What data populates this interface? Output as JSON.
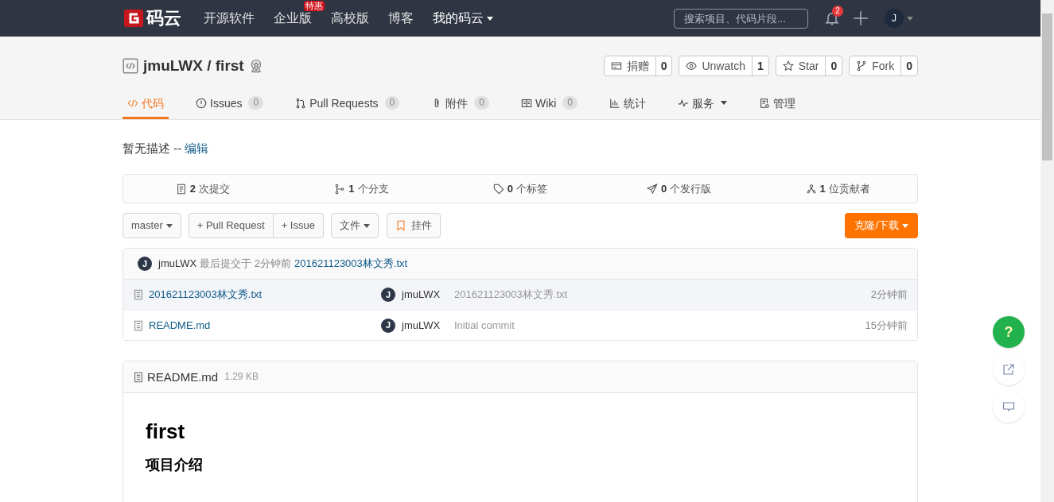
{
  "nav": {
    "logo": "码云",
    "items": [
      {
        "label": "开源软件",
        "dropdown": false
      },
      {
        "label": "企业版",
        "badge": "特惠",
        "dropdown": false
      },
      {
        "label": "高校版",
        "dropdown": false
      },
      {
        "label": "博客",
        "dropdown": false
      },
      {
        "label": "我的码云",
        "dropdown": true
      }
    ],
    "search": {
      "placeholder": "搜索项目、代码片段..."
    },
    "notifications": "2",
    "avatar": "J"
  },
  "repo": {
    "owner": "jmuLWX",
    "separator": "/",
    "name": "first",
    "actions": [
      {
        "kind": "donate",
        "label": "捐赠",
        "count": "0"
      },
      {
        "kind": "watch",
        "label": "Unwatch",
        "count": "1"
      },
      {
        "kind": "star",
        "label": "Star",
        "count": "0"
      },
      {
        "kind": "fork",
        "label": "Fork",
        "count": "0"
      }
    ],
    "tabs": [
      {
        "kind": "code",
        "label": "代码",
        "selected": true,
        "dropdown": false
      },
      {
        "kind": "issues",
        "label": "Issues",
        "count": "0",
        "selected": false,
        "dropdown": false
      },
      {
        "kind": "pr",
        "label": "Pull Requests",
        "count": "0",
        "selected": false,
        "dropdown": false
      },
      {
        "kind": "attach",
        "label": "附件",
        "count": "0",
        "selected": false,
        "dropdown": false
      },
      {
        "kind": "wiki",
        "label": "Wiki",
        "count": "0",
        "selected": false,
        "dropdown": false
      },
      {
        "kind": "stats",
        "label": "统计",
        "selected": false,
        "dropdown": false
      },
      {
        "kind": "service",
        "label": "服务",
        "selected": false,
        "dropdown": true
      },
      {
        "kind": "manage",
        "label": "管理",
        "selected": false,
        "dropdown": false
      }
    ]
  },
  "description": {
    "text": "暂无描述",
    "separator": "--",
    "link": "编辑"
  },
  "stats": [
    {
      "kind": "commits",
      "count": "2",
      "label": "次提交"
    },
    {
      "kind": "branches",
      "count": "1",
      "label": "个分支"
    },
    {
      "kind": "tags",
      "count": "0",
      "label": "个标签"
    },
    {
      "kind": "releases",
      "count": "0",
      "label": "个发行版"
    },
    {
      "kind": "contributors",
      "count": "1",
      "label": "位贡献者"
    }
  ],
  "toolbar": {
    "branch": "master",
    "pull_request": "+ Pull Request",
    "issue": "+ Issue",
    "file": "文件",
    "widget": "挂件",
    "clone": "克隆/下载"
  },
  "last_commit": {
    "avatar": "J",
    "author": "jmuLWX",
    "text": "最后提交于",
    "time": "2分钟前",
    "message": "201621123003林文秀.txt"
  },
  "files": [
    {
      "name": "201621123003林文秀.txt",
      "avatar": "J",
      "author": "jmuLWX",
      "message": "201621123003林文秀.txt",
      "time": "2分钟前",
      "selected": true
    },
    {
      "name": "README.md",
      "avatar": "J",
      "author": "jmuLWX",
      "message": "Initial commit",
      "time": "15分钟前",
      "selected": false
    }
  ],
  "readme": {
    "filename": "README.md",
    "size": "1.29 KB",
    "title": "first",
    "heading": "项目介绍"
  },
  "float_buttons": [
    {
      "kind": "help",
      "label": "?"
    },
    {
      "kind": "edit"
    },
    {
      "kind": "chat"
    }
  ]
}
